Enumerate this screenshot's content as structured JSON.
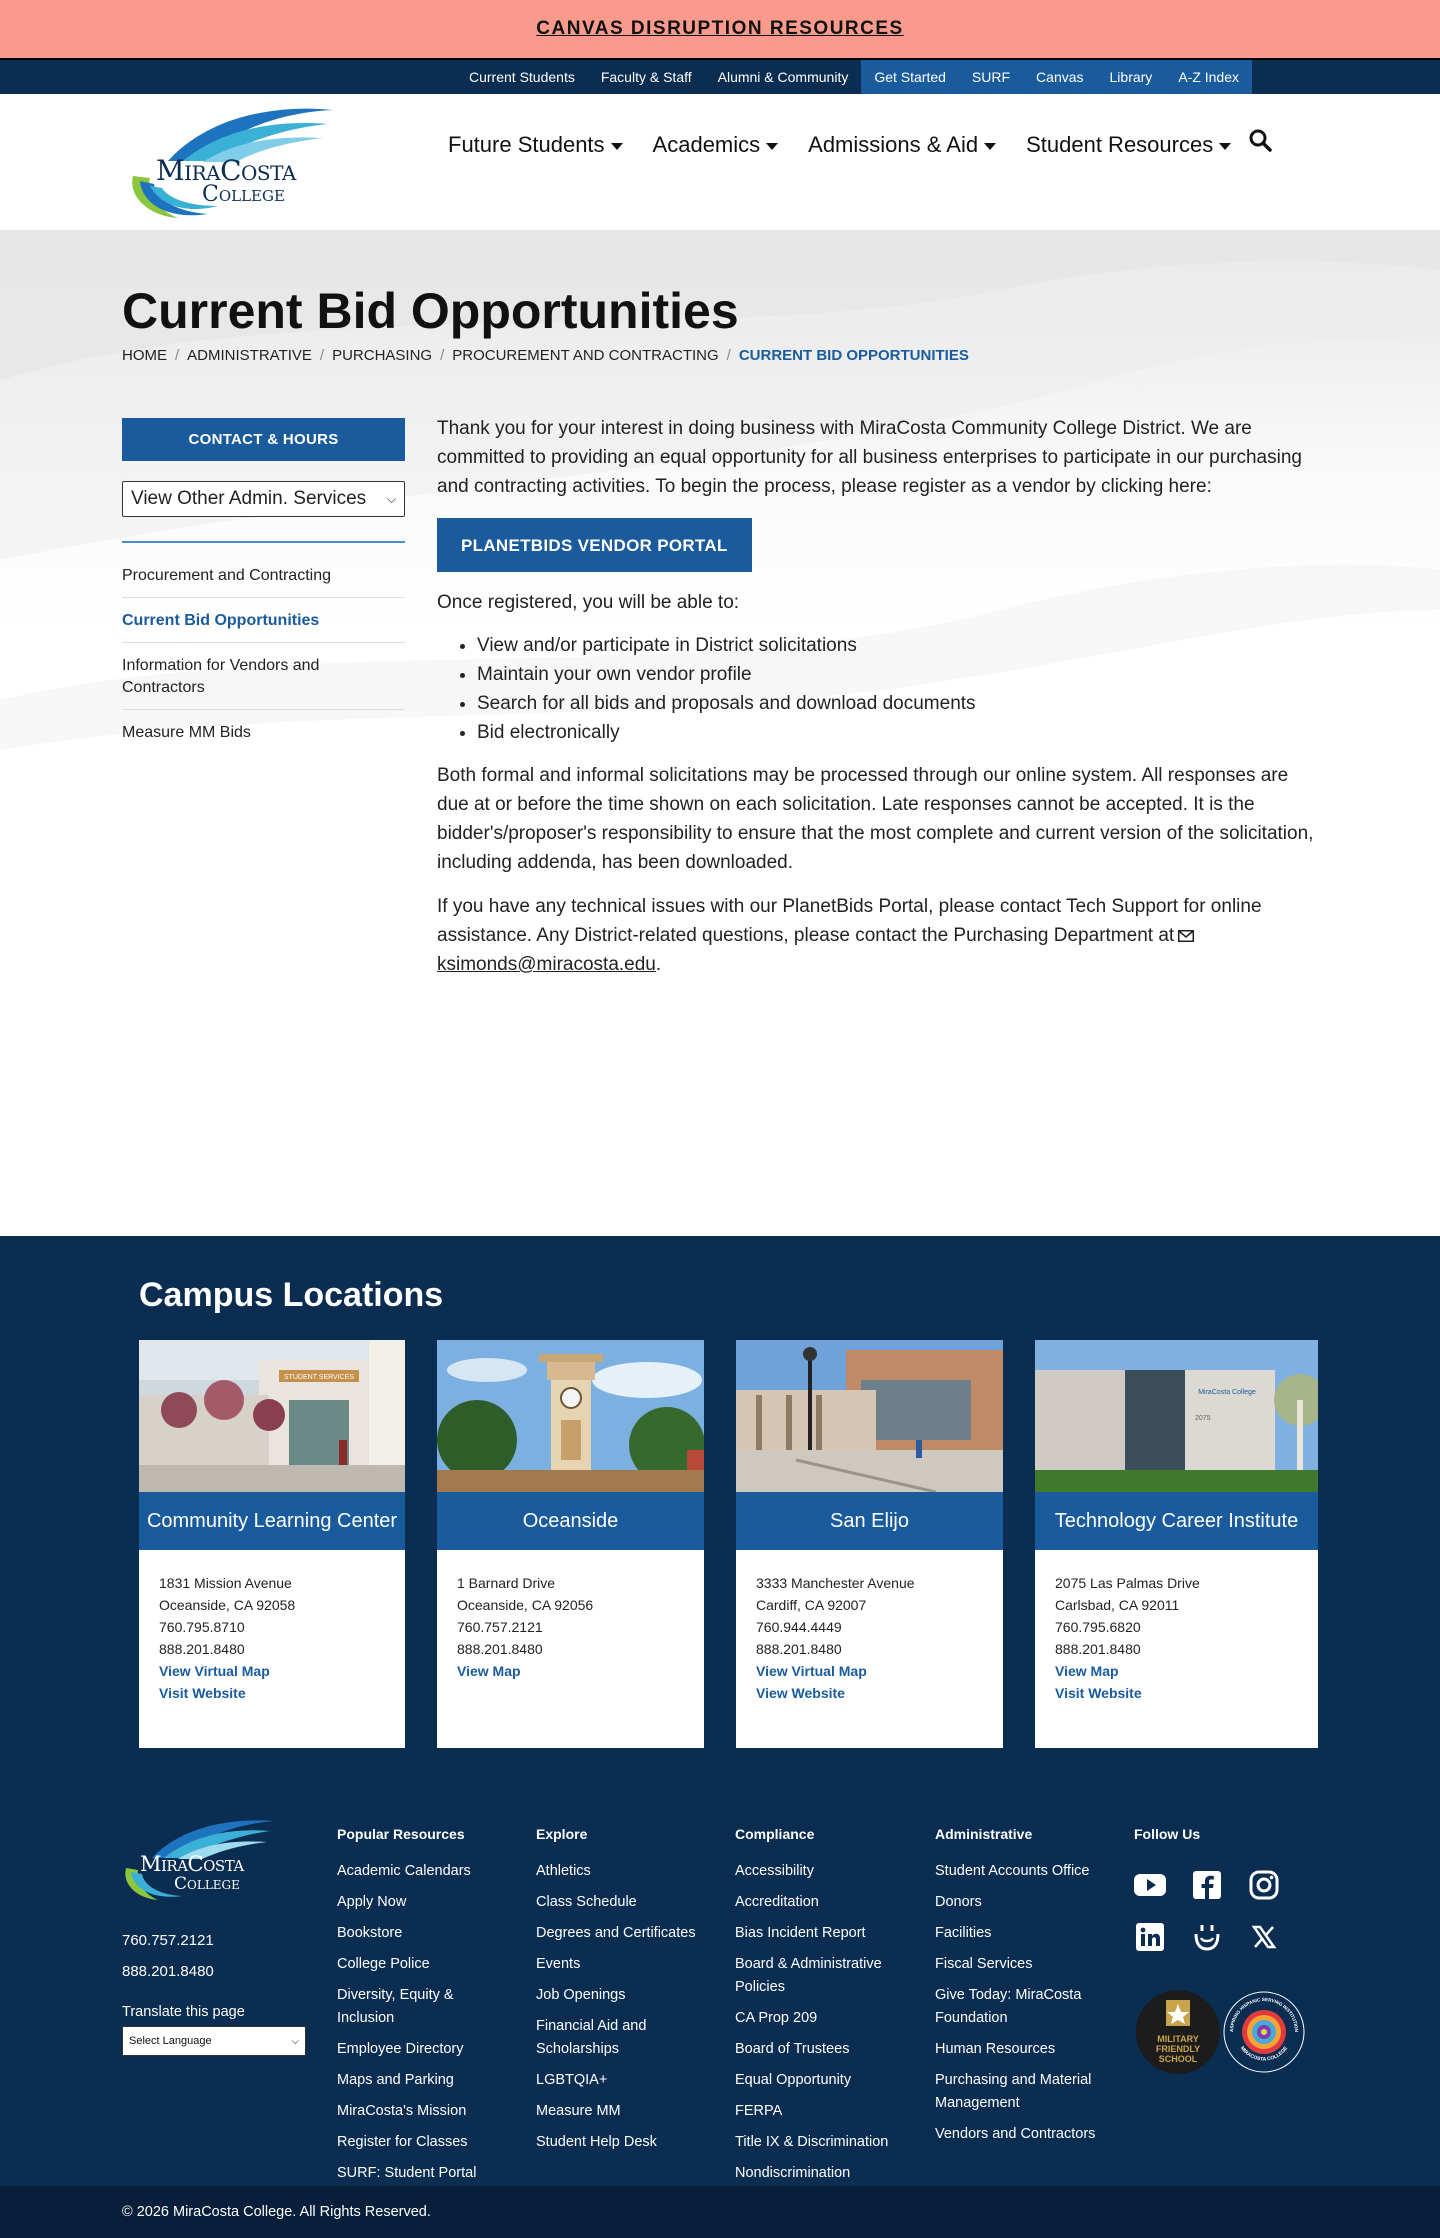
{
  "alert": {
    "label": "CANVAS DISRUPTION RESOURCES"
  },
  "utility": [
    "Current Students",
    "Faculty & Staff",
    "Alumni & Community",
    "Get Started",
    "SURF",
    "Canvas",
    "Library",
    "A-Z Index"
  ],
  "header": {
    "logo_text_1": "MiraCosta",
    "logo_text_2": "College",
    "nav": [
      "Future Students",
      "Academics",
      "Admissions & Aid",
      "Student Resources"
    ]
  },
  "page": {
    "title": "Current Bid Opportunities",
    "breadcrumb": [
      "HOME",
      "ADMINISTRATIVE",
      "PURCHASING",
      "PROCUREMENT AND CONTRACTING",
      "CURRENT BID OPPORTUNITIES"
    ]
  },
  "sidebar": {
    "contact_label": "CONTACT & HOURS",
    "select_value": "View Other Admin. Services",
    "items": [
      "Procurement and Contracting",
      "Current Bid Opportunities",
      "Information for Vendors and Contractors",
      "Measure MM Bids"
    ]
  },
  "content": {
    "intro": "Thank you for your interest in doing business with MiraCosta Community College District. We are committed to providing an equal opportunity for all business enterprises to participate in our purchasing and contracting activities. To begin the process, please register as a vendor by clicking here:",
    "portal_label": "PLANETBIDS VENDOR PORTAL",
    "registered": "Once registered, you will be able to:",
    "bullets": [
      "View and/or participate in District solicitations",
      "Maintain your own vendor profile",
      "Search for all bids and proposals and download documents",
      "Bid electronically"
    ],
    "formal": "Both formal and informal solicitations may be processed through our online system. All responses are due at or before the time shown on each solicitation. Late responses cannot be accepted. It is the bidder's/proposer's responsibility to ensure that the most complete and current version of the solicitation, including addenda, has been downloaded.",
    "support": "If you have any technical issues with our PlanetBids Portal, please contact Tech Support for online assistance. Any District-related questions, please contact the Purchasing Department at",
    "email": "ksimonds@miracosta.edu",
    "period": "."
  },
  "campus": {
    "heading": "Campus Locations",
    "cards": [
      {
        "name": "Community Learning Center",
        "sign": "STUDENT SERVICES",
        "addr1": "1831 Mission Avenue",
        "addr2": "Oceanside, CA 92058",
        "phone1": "760.795.8710",
        "phone2": "888.201.8480",
        "link1": "View Virtual Map",
        "link2": "Visit Website"
      },
      {
        "name": "Oceanside",
        "addr1": "1 Barnard Drive",
        "addr2": "Oceanside, CA 92056",
        "phone1": "760.757.2121",
        "phone2": "888.201.8480",
        "link1": "View Map",
        "link2": ""
      },
      {
        "name": "San Elijo",
        "addr1": "3333 Manchester Avenue",
        "addr2": "Cardiff, CA 92007",
        "phone1": "760.944.4449",
        "phone2": "888.201.8480",
        "link1": "View Virtual Map",
        "link2": "View Website"
      },
      {
        "name": "Technology Career Institute",
        "sign": "MiraCosta College",
        "number": "2075",
        "addr1": "2075 Las Palmas Drive",
        "addr2": "Carlsbad, CA 92011",
        "phone1": "760.795.6820",
        "phone2": "888.201.8480",
        "link1": "View Map",
        "link2": "Visit Website"
      }
    ]
  },
  "footer": {
    "phone1": "760.757.2121",
    "phone2": "888.201.8480",
    "translate_label": "Translate this page",
    "translate_value": "Select Language",
    "cols": [
      {
        "title": "Popular Resources",
        "items": [
          "Academic Calendars",
          "Apply Now",
          "Bookstore",
          "College Police",
          "Diversity, Equity & Inclusion",
          "Employee Directory",
          "Maps and Parking",
          "MiraCosta's Mission",
          "Register for Classes",
          "SURF: Student Portal"
        ]
      },
      {
        "title": "Explore",
        "items": [
          "Athletics",
          "Class Schedule",
          "Degrees and Certificates",
          "Events",
          "Job Openings",
          "Financial Aid and Scholarships",
          "LGBTQIA+",
          "Measure MM",
          "Student Help Desk"
        ]
      },
      {
        "title": "Compliance",
        "items": [
          "Accessibility",
          "Accreditation",
          "Bias Incident Report",
          "Board & Administrative Policies",
          "CA Prop 209",
          "Board of Trustees",
          "Equal Opportunity",
          "FERPA",
          "Title IX & Discrimination",
          "Nondiscrimination"
        ]
      },
      {
        "title": "Administrative",
        "items": [
          "Student Accounts Office",
          "Donors",
          "Facilities",
          "Fiscal Services",
          "Give Today: MiraCosta Foundation",
          "Human Resources",
          "Purchasing and Material Management",
          "Vendors and Contractors"
        ]
      }
    ],
    "follow": "Follow Us",
    "badge1": [
      "MILITARY",
      "FRIENDLY",
      "SCHOOL"
    ],
    "badge2_top": "ASPIRING HISPANIC SERVING INSTITUTION",
    "badge2_bottom": "MIRACOSTA COLLEGE",
    "copyright": "© 2026 MiraCosta College. All Rights Reserved."
  }
}
